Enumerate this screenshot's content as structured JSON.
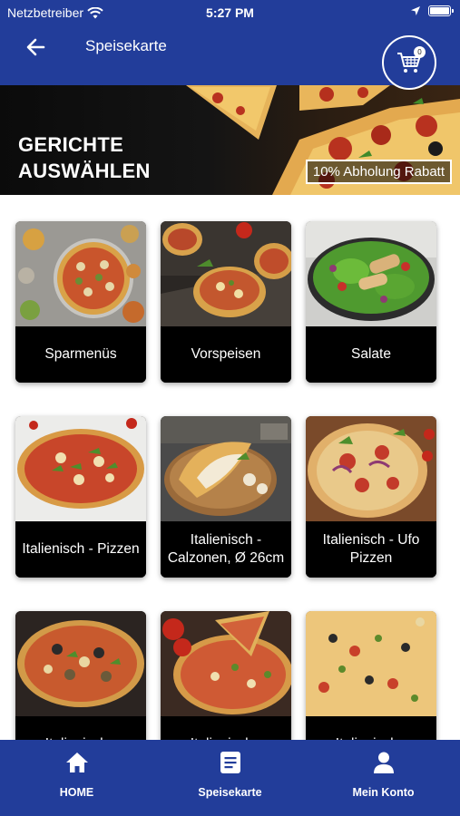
{
  "status_bar": {
    "carrier": "Netzbetreiber",
    "time": "5:27 PM"
  },
  "header": {
    "title": "Speisekarte",
    "cart_count": "0"
  },
  "hero": {
    "title": "GERICHTE AUSWÄHLEN",
    "badge": "10% Abholung Rabatt"
  },
  "categories": [
    {
      "label": "Sparmenüs"
    },
    {
      "label": "Vorspeisen"
    },
    {
      "label": "Salate"
    },
    {
      "label": "Italienisch - Pizzen"
    },
    {
      "label": "Italienisch - Calzonen, Ø 26cm"
    },
    {
      "label": "Italienisch - Ufo Pizzen"
    },
    {
      "label": "Italienisch -"
    },
    {
      "label": "Italienisch -"
    },
    {
      "label": "Italienisch -"
    }
  ],
  "tabbar": {
    "items": [
      {
        "label": "HOME",
        "icon": "home-icon"
      },
      {
        "label": "Speisekarte",
        "icon": "menu-list-icon"
      },
      {
        "label": "Mein Konto",
        "icon": "user-icon"
      }
    ]
  },
  "colors": {
    "brand_blue": "#223d9a",
    "label_bg": "#000000"
  }
}
